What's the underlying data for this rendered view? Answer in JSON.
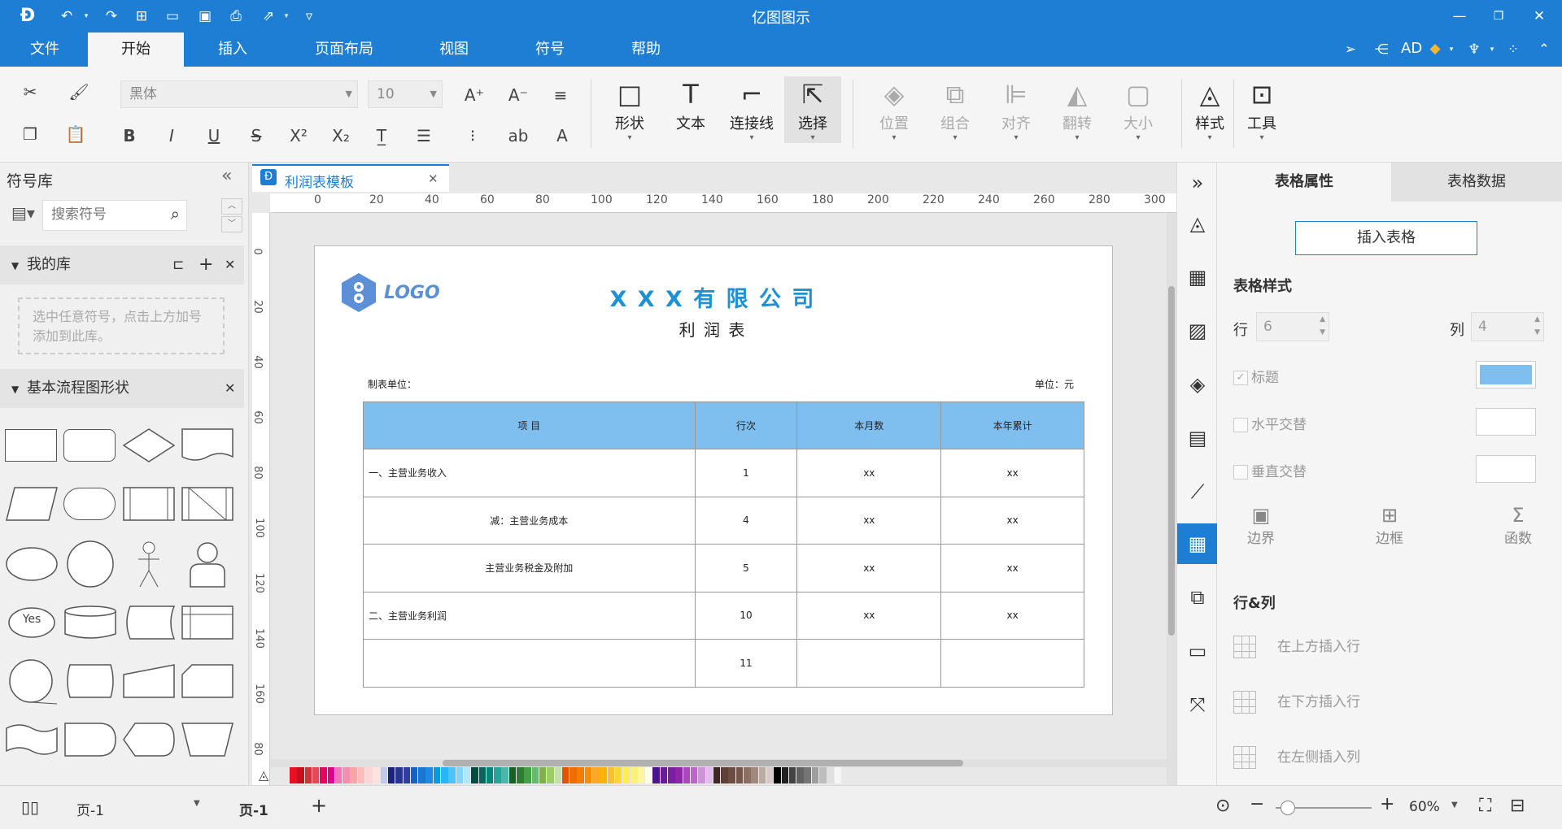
{
  "app": {
    "title": "亿图图示"
  },
  "menu": {
    "items": [
      "文件",
      "开始",
      "插入",
      "页面布局",
      "视图",
      "符号",
      "帮助"
    ],
    "user": "AD"
  },
  "ribbon": {
    "font_family": "黑体",
    "font_size": "10",
    "big_buttons": {
      "shape": "形状",
      "text": "文本",
      "connector": "连接线",
      "select": "选择",
      "position": "位置",
      "group": "组合",
      "align": "对齐",
      "flip": "翻转",
      "size": "大小",
      "style": "样式",
      "tools": "工具"
    }
  },
  "left_panel": {
    "title": "符号库",
    "search_placeholder": "搜索符号",
    "my_library": "我的库",
    "my_library_hint": "选中任意符号，点击上方加号添加到此库。",
    "basic_shapes": "基本流程图形状",
    "yes_label": "Yes"
  },
  "tab": {
    "name": "利润表模板"
  },
  "ruler": {
    "h": [
      "0",
      "20",
      "40",
      "60",
      "80",
      "100",
      "120",
      "140",
      "160",
      "180",
      "200",
      "220",
      "240",
      "260",
      "280",
      "300"
    ],
    "v": [
      "0",
      "20",
      "40",
      "60",
      "80",
      "100",
      "120",
      "140",
      "160",
      "80"
    ]
  },
  "document": {
    "logo_text": "LOGO",
    "company": "X X X 有 限 公 司",
    "title": "利 润 表",
    "unit_left": "制表单位：",
    "unit_right": "单位：元",
    "headers": [
      "项  目",
      "行次",
      "本月数",
      "本年累计"
    ],
    "rows": [
      [
        "一、主营业务收入",
        "1",
        "xx",
        "xx"
      ],
      [
        "减：主营业务成本",
        "4",
        "xx",
        "xx"
      ],
      [
        "主营业务税金及附加",
        "5",
        "xx",
        "xx"
      ],
      [
        "二、主营业务利润",
        "10",
        "xx",
        "xx"
      ],
      [
        "",
        "11",
        "",
        ""
      ]
    ]
  },
  "right_panel": {
    "tab_props": "表格属性",
    "tab_data": "表格数据",
    "insert_table": "插入表格",
    "table_style": "表格样式",
    "rows_label": "行",
    "rows_value": "6",
    "cols_label": "列",
    "cols_value": "4",
    "title_check": "标题",
    "h_alt": "水平交替",
    "v_alt": "垂直交替",
    "boundary": "边界",
    "border": "边框",
    "function": "函数",
    "row_col": "行&列",
    "insert_above": "在上方插入行",
    "insert_below": "在下方插入行",
    "insert_left": "在左侧插入列",
    "title_color": "#7fbff0",
    "accent": "#1e7ed4"
  },
  "status": {
    "page_select": "页-1",
    "page_tab": "页-1",
    "zoom": "60%"
  },
  "palette": [
    "#e81123",
    "#c50f1f",
    "#d13438",
    "#e74856",
    "#ea005e",
    "#e3008c",
    "#f472b6",
    "#f48fb1",
    "#f8a5a5",
    "#fbbcbc",
    "#fcd5d5",
    "#fde2e2",
    "#c3c9e8",
    "#1a237e",
    "#283593",
    "#303f9f",
    "#1565c0",
    "#1976d2",
    "#1e88e5",
    "#039be5",
    "#29b6f6",
    "#4fc3f7",
    "#81d4fa",
    "#b3e5fc",
    "#004d40",
    "#00695c",
    "#00897b",
    "#26a69a",
    "#4db6ac",
    "#1b5e20",
    "#2e7d32",
    "#43a047",
    "#66bb6a",
    "#7cb342",
    "#9ccc65",
    "#c5e1a5",
    "#e65100",
    "#ef6c00",
    "#f57c00",
    "#fb8c00",
    "#ffa726",
    "#ffb300",
    "#fbc02d",
    "#fdd835",
    "#ffee58",
    "#fff176",
    "#fff59d",
    "#fffde7",
    "#4a148c",
    "#6a1b9a",
    "#7b1fa2",
    "#8e24aa",
    "#ab47bc",
    "#ba68c8",
    "#ce93d8",
    "#e1bee7",
    "#3e2723",
    "#5d4037",
    "#6d4c41",
    "#795548",
    "#8d6e63",
    "#a1887f",
    "#bcaaa4",
    "#d7ccc8",
    "#000000",
    "#212121",
    "#424242",
    "#616161",
    "#757575",
    "#9e9e9e",
    "#bdbdbd",
    "#e0e0e0",
    "#f5f5f5"
  ]
}
